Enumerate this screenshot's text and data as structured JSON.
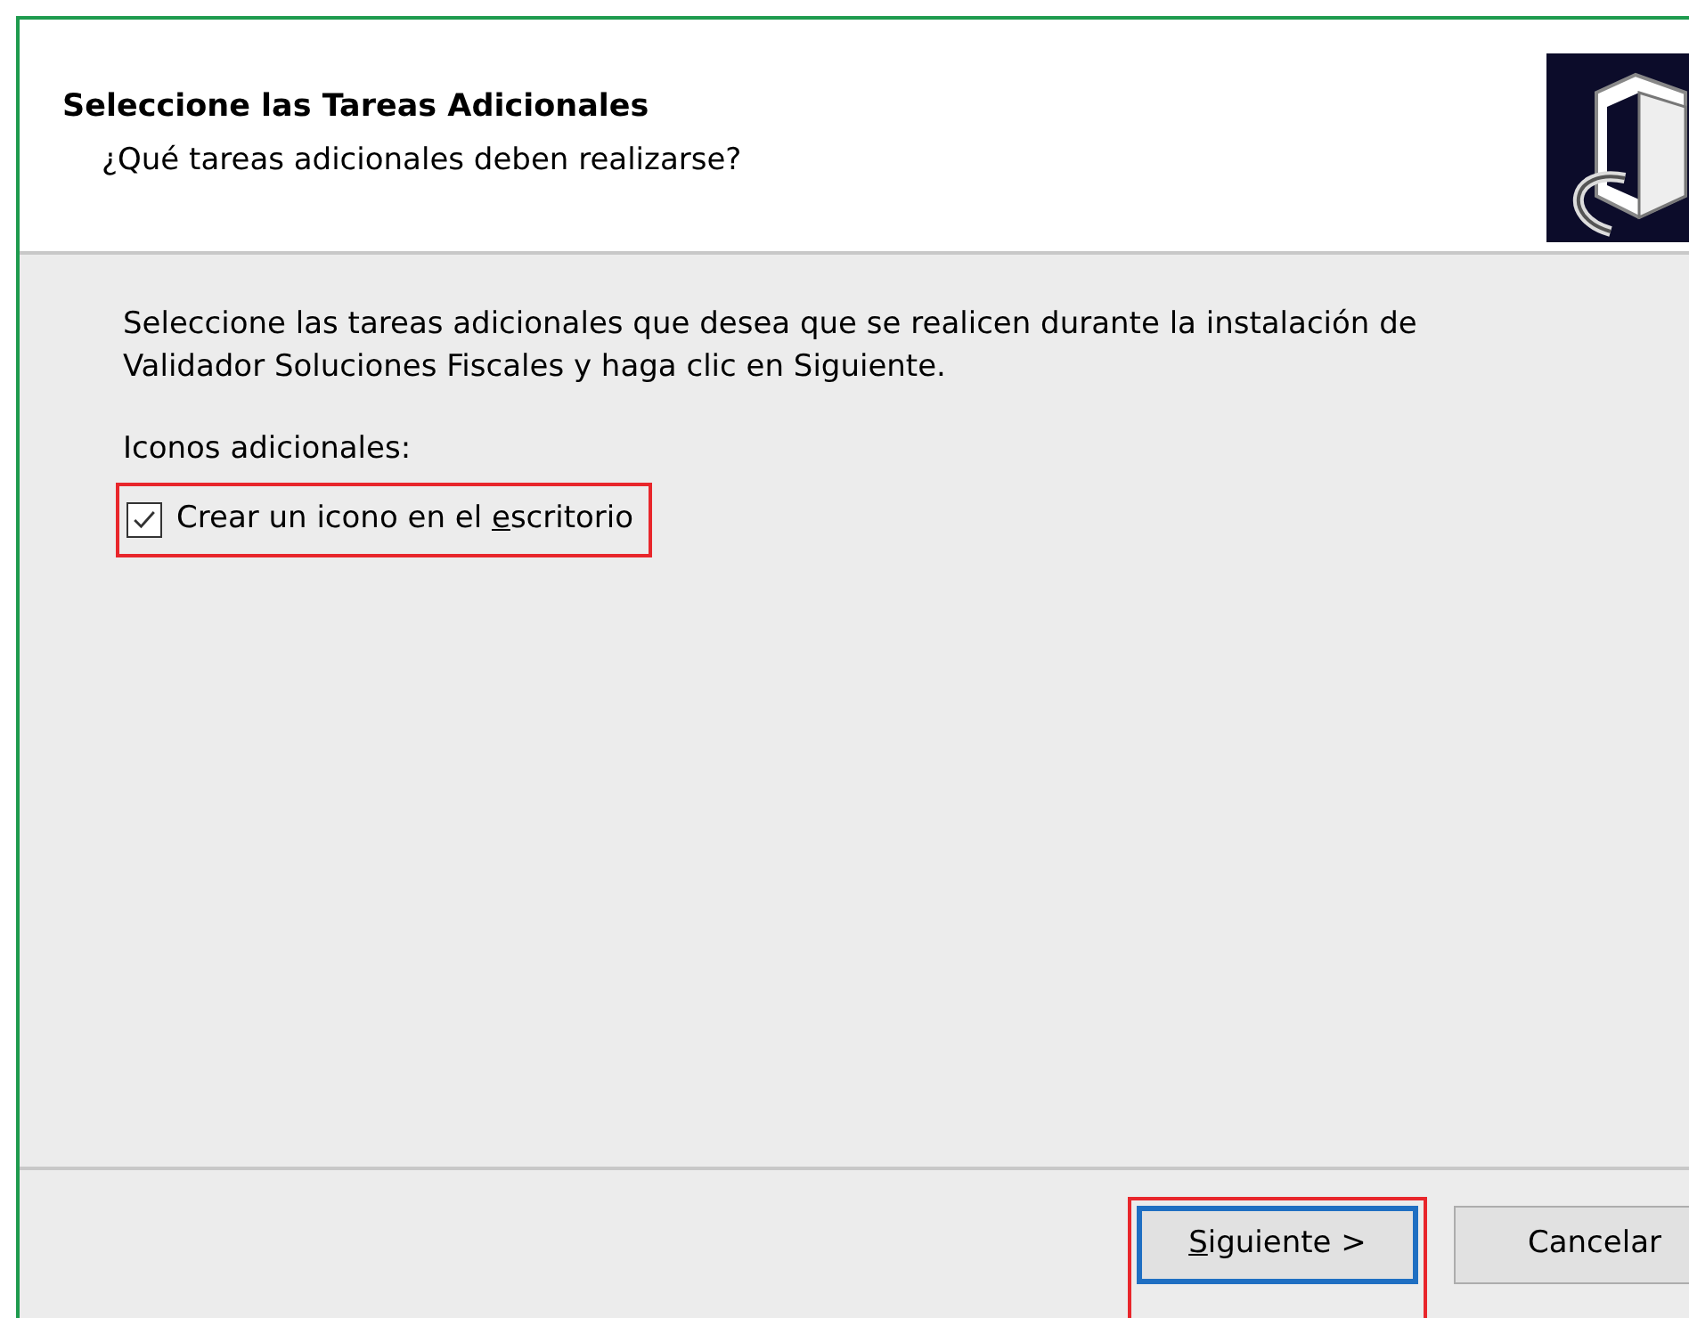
{
  "header": {
    "title": "Seleccione las Tareas Adicionales",
    "subtitle": "¿Qué tareas adicionales deben realizarse?"
  },
  "intro": "Seleccione las tareas adicionales que desea que se realicen durante la instalación de Validador Soluciones Fiscales y haga clic en Siguiente.",
  "group_label": "Iconos adicionales:",
  "tasks": [
    {
      "label_before": "Crear un icono en el ",
      "access_key": "e",
      "label_after": "scritorio",
      "checked": true,
      "highlighted": true
    }
  ],
  "buttons": [
    {
      "access_key": "S",
      "label_after": "iguiente >",
      "default": true,
      "highlighted": true
    },
    {
      "label_before": "Cancelar",
      "default": false,
      "highlighted": false
    }
  ]
}
